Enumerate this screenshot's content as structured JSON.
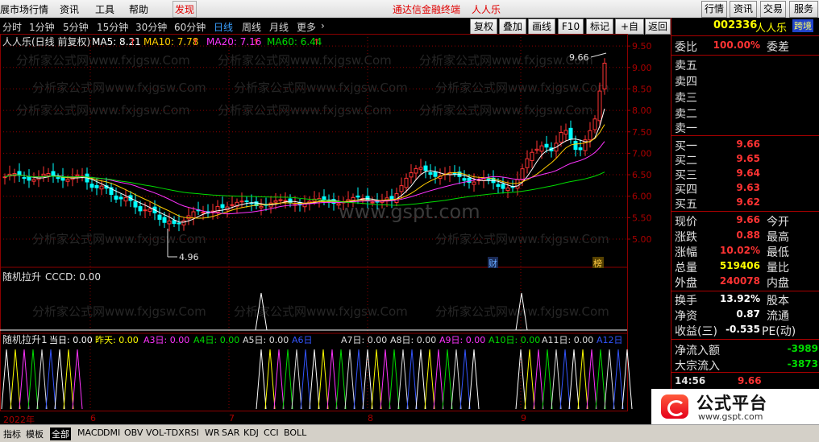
{
  "menu": {
    "items": [
      "展市场行情",
      "资讯",
      "工具",
      "帮助"
    ],
    "find": "发现",
    "center_title": "通达信金融终端",
    "stock_name": "人人乐",
    "right_buttons": [
      "行情",
      "资讯",
      "交易",
      "服务"
    ]
  },
  "periods": {
    "items": [
      "分时",
      "1分钟",
      "5分钟",
      "15分钟",
      "30分钟",
      "60分钟",
      "日线",
      "周线",
      "月线",
      "更多"
    ],
    "active": "日线"
  },
  "tools": {
    "items": [
      "复权",
      "叠加",
      "画线",
      "F10",
      "标记",
      "+自选",
      "返回"
    ]
  },
  "legend": {
    "name": "人人乐(日线 前复权)",
    "ma": [
      {
        "label": "MA5: 8.21",
        "color": "#ffffff"
      },
      {
        "label": "MA10: 7.78",
        "color": "#ffcc00"
      },
      {
        "label": "MA20: 7.16",
        "color": "#ff33ff"
      },
      {
        "label": "MA60: 6.44",
        "color": "#00dd00"
      }
    ]
  },
  "price_axis": {
    "ticks": [
      "9.50",
      "9.00",
      "8.50",
      "8.00",
      "7.50",
      "7.00",
      "6.50",
      "6.00",
      "5.50",
      "5.00"
    ]
  },
  "annotations": {
    "high": "9.66",
    "low": "4.96",
    "cai": "财",
    "bang": "榜"
  },
  "watermark": "分析家公式网www.fxjgsw.Com",
  "center_watermark": "www.gspt.com",
  "ind1": {
    "title": "随机拉升",
    "value": "CCCD: 0.00"
  },
  "ind2": {
    "title": "随机拉升1",
    "labels": [
      {
        "t": "当日: 0.00",
        "c": "#ffffff"
      },
      {
        "t": "昨天: 0.00",
        "c": "#ffff00"
      },
      {
        "t": "A3日: 0.00",
        "c": "#ff33ff"
      },
      {
        "t": "A4日: 0.00",
        "c": "#00dd00"
      },
      {
        "t": "A5日: 0.00",
        "c": "#dddddd"
      },
      {
        "t": "A6日",
        "c": "#3355ff"
      },
      {
        "t": "A7日: 0.00",
        "c": "#dddddd"
      },
      {
        "t": "A8日: 0.00",
        "c": "#dddddd"
      },
      {
        "t": "A9日: 0.00",
        "c": "#ff33ff"
      },
      {
        "t": "A10日: 0.00",
        "c": "#00dd00"
      },
      {
        "t": "A11日: 0.00",
        "c": "#dddddd"
      },
      {
        "t": "A12日",
        "c": "#3355ff"
      }
    ]
  },
  "dates": {
    "items": [
      "2022年",
      "6",
      "7",
      "8",
      "9"
    ]
  },
  "right_panel": {
    "code": "002336",
    "name": "人人乐",
    "tag": "跨境",
    "wb_label": "委比",
    "wb_value": "100.00%",
    "wc_label": "委差",
    "sells": [
      "卖五",
      "卖四",
      "卖三",
      "卖二",
      "卖一"
    ],
    "buys": [
      {
        "l": "买一",
        "v": "9.66"
      },
      {
        "l": "买二",
        "v": "9.65"
      },
      {
        "l": "买三",
        "v": "9.64"
      },
      {
        "l": "买四",
        "v": "9.63"
      },
      {
        "l": "买五",
        "v": "9.62"
      }
    ],
    "stats": [
      {
        "l": "现价",
        "v": "9.66",
        "c": "#ff3333",
        "l2": "今开"
      },
      {
        "l": "涨跌",
        "v": "0.88",
        "c": "#ff3333",
        "l2": "最高"
      },
      {
        "l": "涨幅",
        "v": "10.02%",
        "c": "#ff3333",
        "l2": "最低"
      },
      {
        "l": "总量",
        "v": "519406",
        "c": "#ffff00",
        "l2": "量比"
      },
      {
        "l": "外盘",
        "v": "240078",
        "c": "#ff3333",
        "l2": "内盘"
      },
      {
        "l": "换手",
        "v": "13.92%",
        "c": "#ffffff",
        "l2": "股本"
      },
      {
        "l": "净资",
        "v": "0.87",
        "c": "#ffffff",
        "l2": "流通"
      },
      {
        "l": "收益(三)",
        "v": "-0.535",
        "c": "#ffffff",
        "l2": "PE(动)"
      }
    ],
    "flows": [
      {
        "l": "净流入额",
        "v": "-3989"
      },
      {
        "l": "大宗流入",
        "v": "-3873"
      }
    ],
    "tick": {
      "time": "14:56",
      "price": "9.66"
    }
  },
  "bottom_tabs": {
    "items": [
      "指标",
      "模板",
      "全部",
      "MACD",
      "DMI",
      "OBV",
      "VOL-TDX",
      "RSI",
      "WR",
      "SAR",
      "KDJ",
      "CCI",
      "BOLL"
    ],
    "active": "全部"
  },
  "logo": {
    "title": "公式平台",
    "url": "www.gspt.com"
  },
  "colors": {
    "up": "#ff3333",
    "down": "#00ffff",
    "grid": "#8b0000",
    "ma5": "#ffffff",
    "ma10": "#ffcc00",
    "ma20": "#ff33ff",
    "ma60": "#00dd00"
  }
}
